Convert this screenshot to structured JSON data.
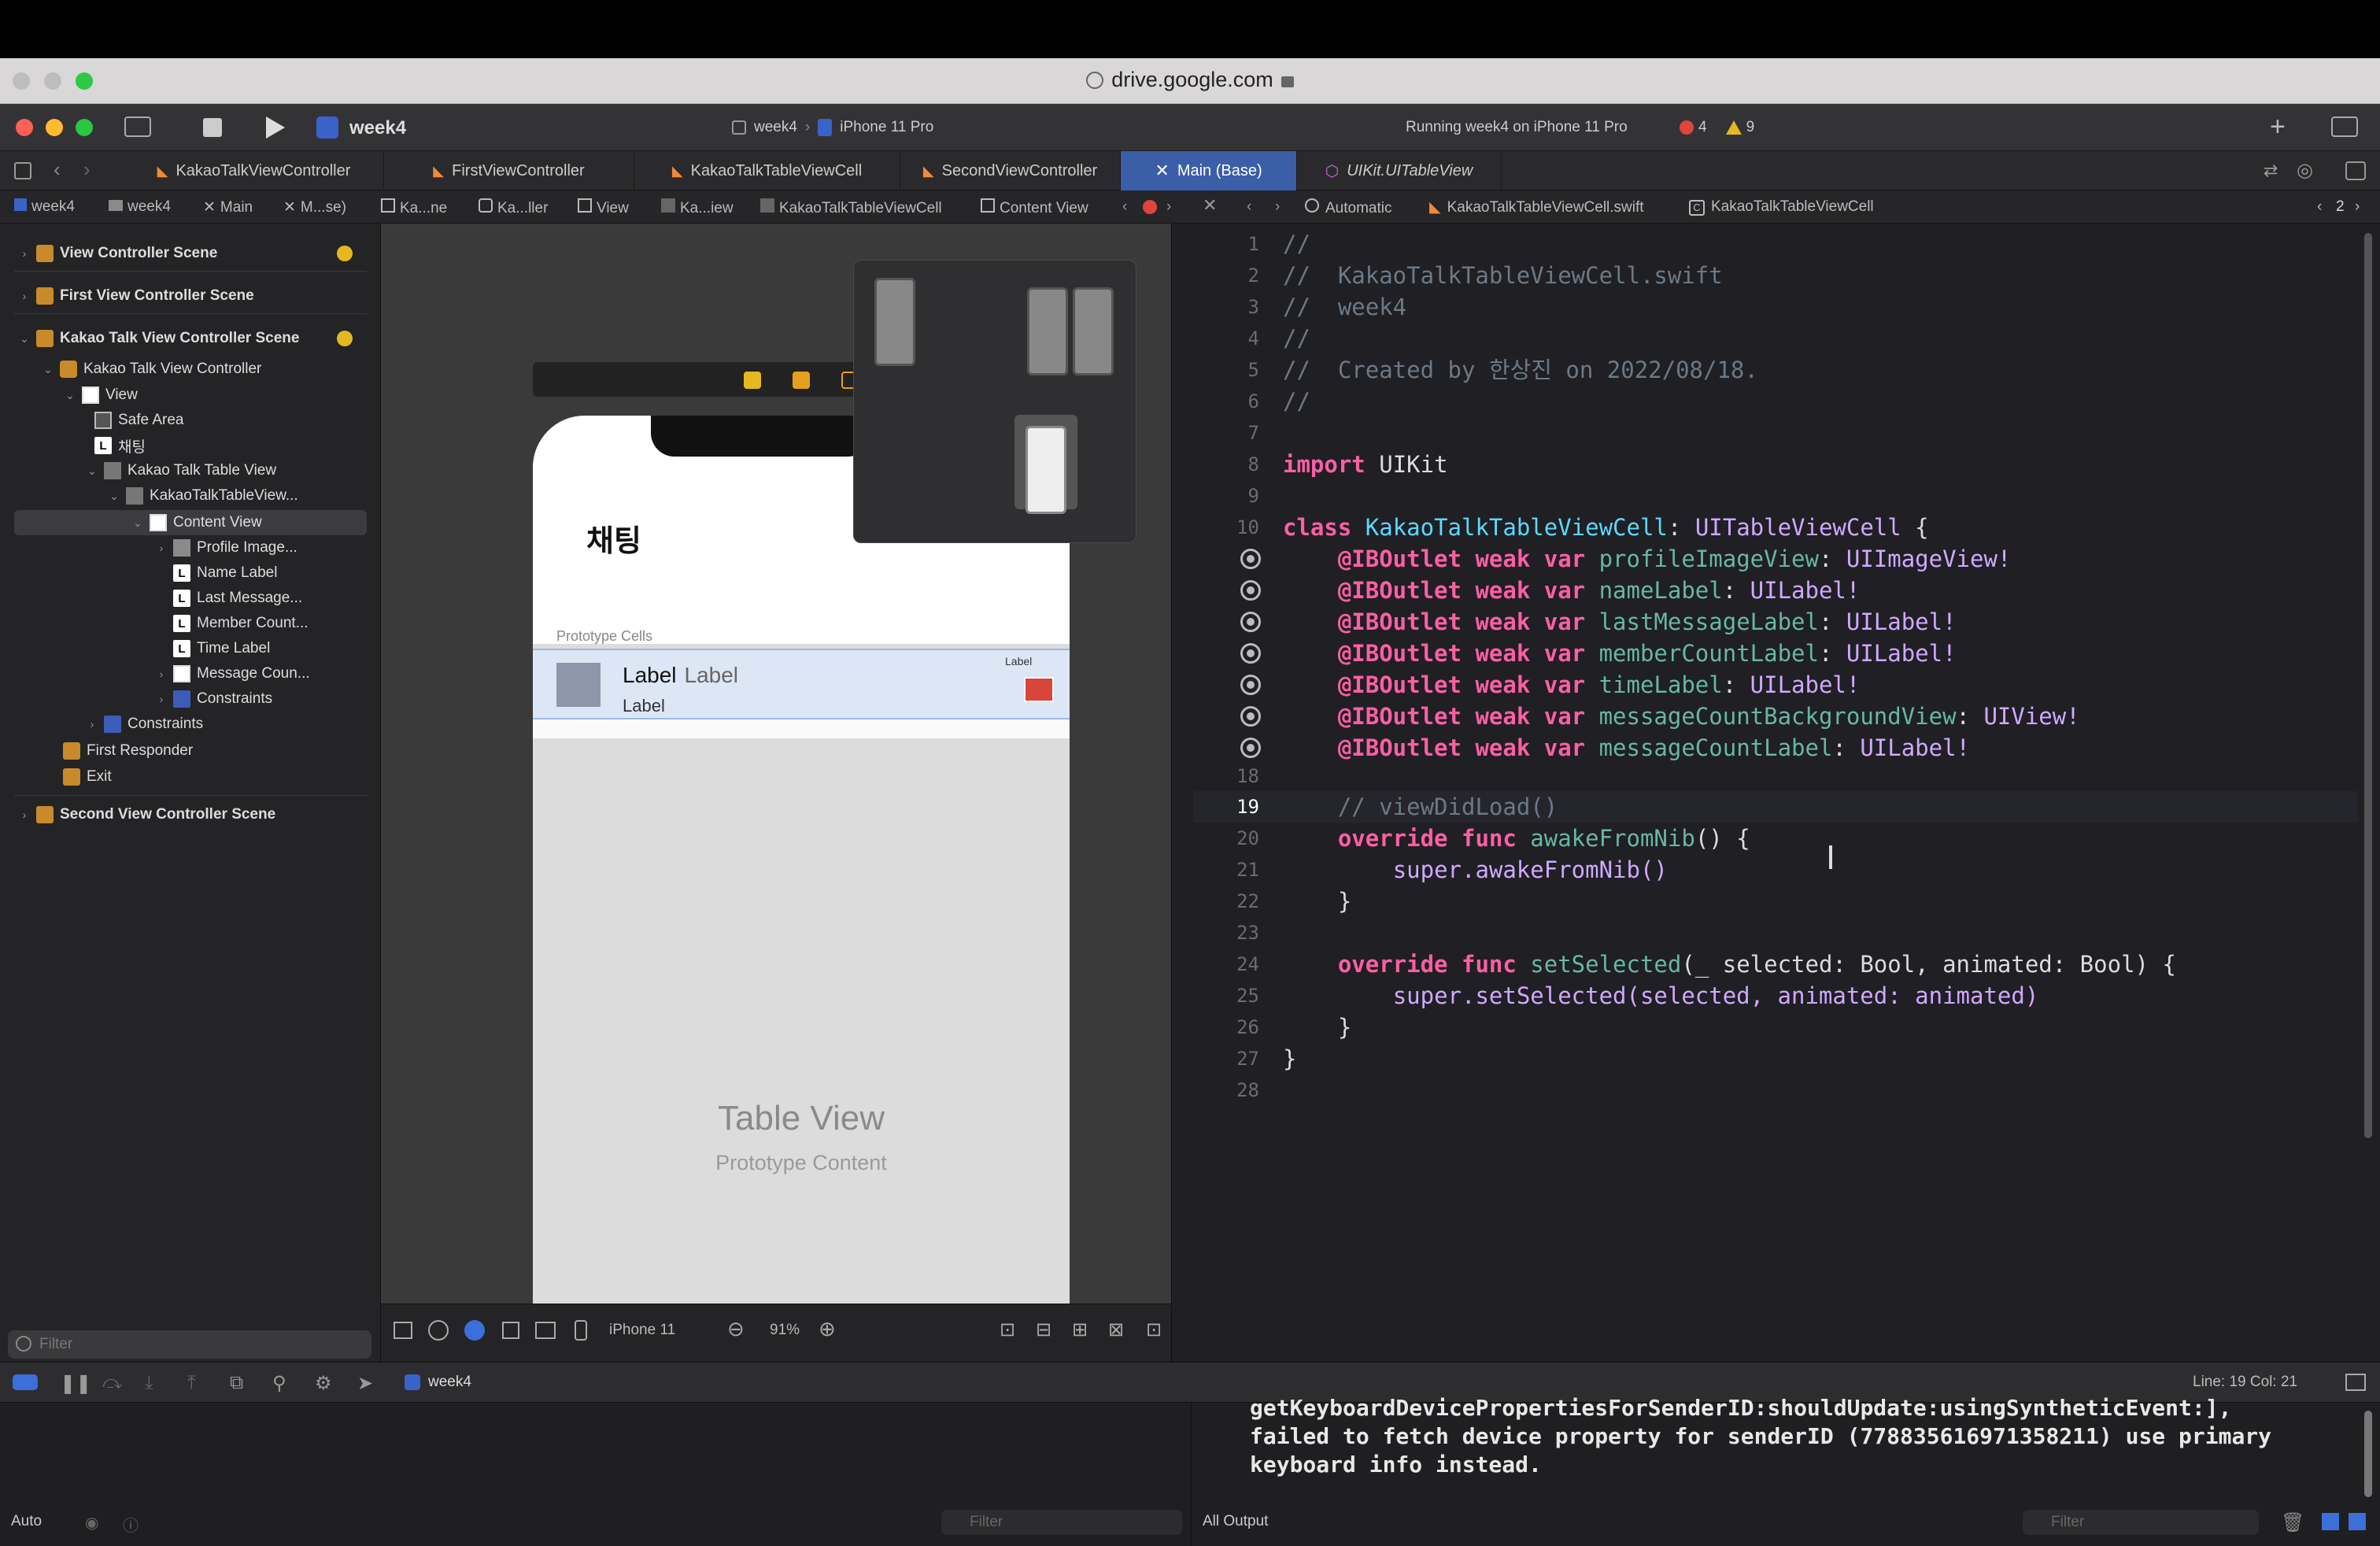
{
  "browser": {
    "url": "drive.google.com"
  },
  "toolbar": {
    "project": "week4",
    "scheme": "week4",
    "device": "iPhone 11 Pro",
    "status": "Running week4 on iPhone 11 Pro",
    "errors": "4",
    "warnings": "9"
  },
  "tabs": [
    {
      "label": "KakaoTalkViewController"
    },
    {
      "label": "FirstViewController"
    },
    {
      "label": "KakaoTalkTableViewCell"
    },
    {
      "label": "SecondViewController"
    },
    {
      "label": "Main (Base)"
    },
    {
      "label": "UIKit.UITableView"
    }
  ],
  "jumpbar": {
    "crumbs": [
      "week4",
      "week4",
      "Main",
      "M...se)",
      "Ka...ne",
      "Ka...ller",
      "View",
      "Ka...iew",
      "KakaoTalkTableViewCell",
      "Content View"
    ],
    "right": [
      "Automatic",
      "KakaoTalkTableViewCell.swift",
      "KakaoTalkTableViewCell"
    ],
    "count": "2"
  },
  "navigator": {
    "rows": [
      {
        "label": "View Controller Scene"
      },
      {
        "label": "First View Controller Scene"
      },
      {
        "label": "Kakao Talk View Controller Scene"
      },
      {
        "label": "Kakao Talk View Controller"
      },
      {
        "label": "View"
      },
      {
        "label": "Safe Area"
      },
      {
        "label": "채팅"
      },
      {
        "label": "Kakao Talk Table View"
      },
      {
        "label": "KakaoTalkTableView..."
      },
      {
        "label": "Content View"
      },
      {
        "label": "Profile Image..."
      },
      {
        "label": "Name Label"
      },
      {
        "label": "Last Message..."
      },
      {
        "label": "Member Count..."
      },
      {
        "label": "Time Label"
      },
      {
        "label": "Message Coun..."
      },
      {
        "label": "Constraints"
      },
      {
        "label": "Constraints"
      },
      {
        "label": "First Responder"
      },
      {
        "label": "Exit"
      },
      {
        "label": "Second View Controller Scene"
      }
    ],
    "filter_placeholder": "Filter"
  },
  "canvas": {
    "title": "채팅",
    "prototype_header": "Prototype Cells",
    "cell_label": "Label",
    "cell_label2": "Label",
    "cell_sub": "Label",
    "cell_time": "Label",
    "table_title": "Table View",
    "table_sub": "Prototype Content",
    "device": "iPhone 11",
    "zoom": "91%"
  },
  "code": {
    "lines": [
      {
        "n": "1"
      },
      {
        "n": "2"
      },
      {
        "n": "3"
      },
      {
        "n": "4"
      },
      {
        "n": "5"
      },
      {
        "n": "6"
      },
      {
        "n": "7"
      },
      {
        "n": "8"
      },
      {
        "n": "9"
      },
      {
        "n": "10"
      },
      {
        "n": "18"
      },
      {
        "n": "19"
      },
      {
        "n": "20"
      },
      {
        "n": "21"
      },
      {
        "n": "22"
      },
      {
        "n": "23"
      },
      {
        "n": "24"
      },
      {
        "n": "25"
      },
      {
        "n": "26"
      },
      {
        "n": "27"
      },
      {
        "n": "28"
      }
    ],
    "l1": "//",
    "l2": "//  KakaoTalkTableViewCell.swift",
    "l3": "//  week4",
    "l4": "//",
    "l5": "//  Created by 한상진 on 2022/08/18.",
    "l6": "//",
    "l8_kw": "import",
    "l8_mod": "UIKit",
    "l10_kw": "class",
    "l10_name": "KakaoTalkTableViewCell",
    "l10_super": "UITableViewCell",
    "outlets": [
      {
        "name": "profileImageView",
        "type": "UIImageView!"
      },
      {
        "name": "nameLabel",
        "type": "UILabel!"
      },
      {
        "name": "lastMessageLabel",
        "type": "UILabel!"
      },
      {
        "name": "memberCountLabel",
        "type": "UILabel!"
      },
      {
        "name": "timeLabel",
        "type": "UILabel!"
      },
      {
        "name": "messageCountBackgroundView",
        "type": "UIView!"
      },
      {
        "name": "messageCountLabel",
        "type": "UILabel!"
      }
    ],
    "outlet_prefix": "@IBOutlet weak var",
    "l19": "// viewDidLoad()",
    "l20_fn": "awakeFromNib",
    "l21_call": "super.awakeFromNib()",
    "l24_fn": "setSelected",
    "l24_params": "(_ selected: Bool, animated: Bool) {",
    "l25_call": "super.setSelected(selected, animated: animated)"
  },
  "statusbar": {
    "position": "Line: 19  Col: 21",
    "target": "week4"
  },
  "console": {
    "lines": [
      "getKeyboardDevicePropertiesForSenderID:shouldUpdate:usingSyntheticEvent:],",
      "failed to fetch device property for senderID (778835616971358211) use primary",
      "keyboard info instead."
    ],
    "output_selector": "All Output",
    "filter_placeholder": "Filter",
    "auto_label": "Auto"
  },
  "colors": {
    "keyword": "#fc5fa3",
    "type": "#5dd8ff",
    "comment": "#6c7986",
    "active_tab": "#3a5fa8"
  }
}
